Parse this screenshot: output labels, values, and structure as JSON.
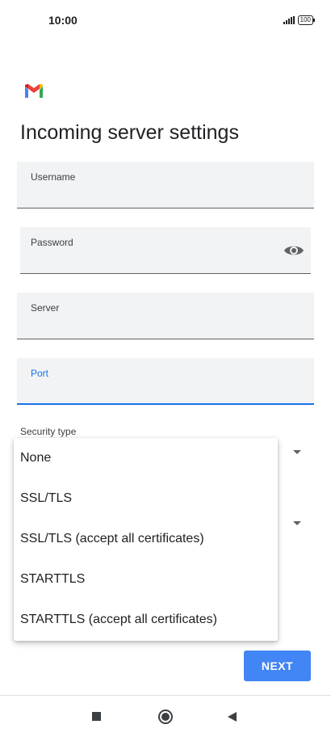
{
  "status_bar": {
    "time": "10:00",
    "battery": "100"
  },
  "app": {
    "icon": "gmail-icon"
  },
  "page": {
    "title": "Incoming server settings"
  },
  "fields": {
    "username": {
      "label": "Username",
      "value": ""
    },
    "password": {
      "label": "Password",
      "value": "",
      "toggle_icon": "eye-icon"
    },
    "server": {
      "label": "Server",
      "value": ""
    },
    "port": {
      "label": "Port",
      "value": ""
    }
  },
  "security_type": {
    "label": "Security type",
    "options": [
      "None",
      "SSL/TLS",
      "SSL/TLS (accept all certificates)",
      "STARTTLS",
      "STARTTLS (accept all certificates)"
    ]
  },
  "actions": {
    "next_label": "NEXT"
  },
  "colors": {
    "accent": "#1a73e8",
    "button": "#4285f4",
    "field_bg": "#f1f3f4"
  }
}
